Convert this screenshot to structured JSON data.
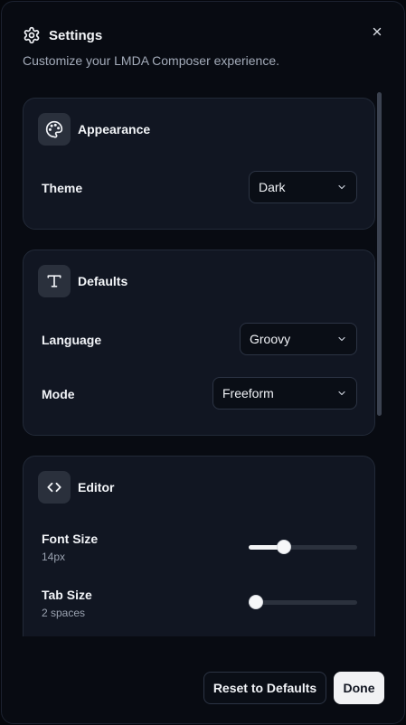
{
  "dialog": {
    "title": "Settings",
    "subtitle": "Customize your LMDA Composer experience.",
    "title_icon": "gear-icon",
    "close_icon": "close-icon"
  },
  "sections": {
    "appearance": {
      "title": "Appearance",
      "icon": "palette-icon",
      "theme": {
        "label": "Theme",
        "value": "Dark"
      }
    },
    "defaults": {
      "title": "Defaults",
      "icon": "text-t-icon",
      "language": {
        "label": "Language",
        "value": "Groovy"
      },
      "mode": {
        "label": "Mode",
        "value": "Freeform"
      }
    },
    "editor": {
      "title": "Editor",
      "icon": "code-brackets-icon",
      "font_size": {
        "label": "Font Size",
        "value_text": "14px",
        "level": 0.3
      },
      "tab_size": {
        "label": "Tab Size",
        "value_text": "2 spaces",
        "level": 0.0
      }
    }
  },
  "footer": {
    "reset_label": "Reset to Defaults",
    "done_label": "Done"
  },
  "colors": {
    "background": "#080b12",
    "card": "#111622",
    "primary_button": "#f1f2f4"
  }
}
